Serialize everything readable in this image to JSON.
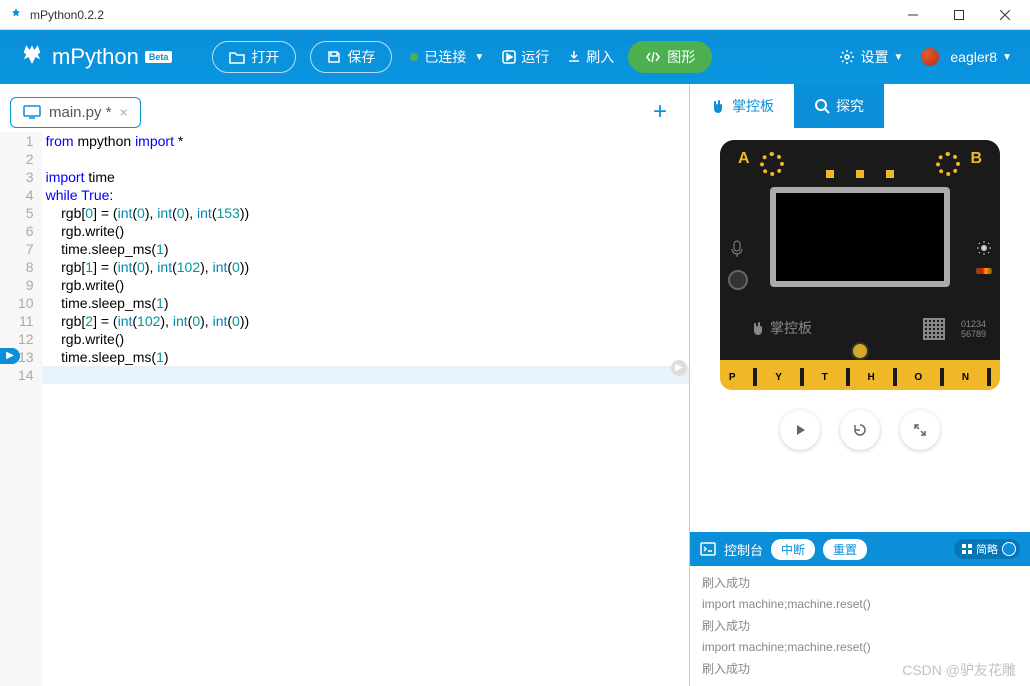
{
  "window": {
    "title": "mPython0.2.2"
  },
  "logo": {
    "text": "mPython",
    "badge": "Beta"
  },
  "toolbar": {
    "open": "打开",
    "save": "保存",
    "connected": "已连接",
    "run": "运行",
    "flash": "刷入",
    "graphics": "图形",
    "settings": "设置",
    "user": "eagler8"
  },
  "tabs": {
    "file": "main.py *",
    "add": "+"
  },
  "code": {
    "lines": [
      {
        "n": "1",
        "html": "<span class='kw'>from</span> mpython <span class='kw'>import</span> *"
      },
      {
        "n": "2",
        "html": ""
      },
      {
        "n": "3",
        "html": "<span class='kw'>import</span> time"
      },
      {
        "n": "4",
        "html": "<span class='kw'>while</span> <span class='kw'>True</span>:"
      },
      {
        "n": "5",
        "html": "    rgb[<span class='num'>0</span>] = (<span class='fn'>int</span>(<span class='num'>0</span>), <span class='fn'>int</span>(<span class='num'>0</span>), <span class='fn'>int</span>(<span class='num'>153</span>))"
      },
      {
        "n": "6",
        "html": "    rgb.write()"
      },
      {
        "n": "7",
        "html": "    time.sleep_ms(<span class='num'>1</span>)"
      },
      {
        "n": "8",
        "html": "    rgb[<span class='num'>1</span>] = (<span class='fn'>int</span>(<span class='num'>0</span>), <span class='fn'>int</span>(<span class='num'>102</span>), <span class='fn'>int</span>(<span class='num'>0</span>))"
      },
      {
        "n": "9",
        "html": "    rgb.write()"
      },
      {
        "n": "10",
        "html": "    time.sleep_ms(<span class='num'>1</span>)"
      },
      {
        "n": "11",
        "html": "    rgb[<span class='num'>2</span>] = (<span class='fn'>int</span>(<span class='num'>102</span>), <span class='fn'>int</span>(<span class='num'>0</span>), <span class='fn'>int</span>(<span class='num'>0</span>))"
      },
      {
        "n": "12",
        "html": "    rgb.write()"
      },
      {
        "n": "13",
        "html": "    time.sleep_ms(<span class='num'>1</span>)"
      },
      {
        "n": "14",
        "html": ""
      }
    ],
    "highlight_line": 14
  },
  "right": {
    "tab1": "掌控板",
    "tab2": "探究",
    "board_brand": "掌控板",
    "serial1": "01234",
    "serial2": "56789",
    "edge_letters": [
      "P",
      "Y",
      "T",
      "H",
      "O",
      "N"
    ]
  },
  "console": {
    "title": "控制台",
    "interrupt": "中断",
    "reset": "重置",
    "simple": "简略",
    "lines": [
      "刷入成功",
      "import machine;machine.reset()",
      "刷入成功",
      "import machine;machine.reset()",
      "刷入成功"
    ]
  },
  "watermark": "CSDN @驴友花雕"
}
